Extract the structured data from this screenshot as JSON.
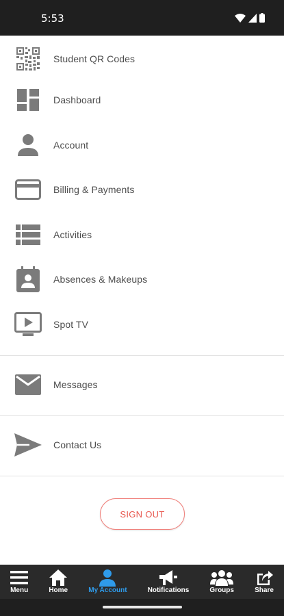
{
  "status_bar": {
    "time": "5:53"
  },
  "menu": {
    "items": [
      {
        "label": "Student QR Codes",
        "icon": "qr-code-icon"
      },
      {
        "label": "Dashboard",
        "icon": "dashboard-icon"
      },
      {
        "label": "Account",
        "icon": "person-icon"
      },
      {
        "label": "Billing & Payments",
        "icon": "credit-card-icon"
      },
      {
        "label": "Activities",
        "icon": "list-icon"
      },
      {
        "label": "Absences & Makeups",
        "icon": "contact-calendar-icon"
      },
      {
        "label": "Spot TV",
        "icon": "tv-play-icon"
      },
      {
        "label": "Messages",
        "icon": "envelope-icon"
      },
      {
        "label": "Contact Us",
        "icon": "send-icon"
      }
    ]
  },
  "sign_out": {
    "label": "SIGN OUT",
    "color": "#e8584f"
  },
  "bottom_nav": {
    "items": [
      {
        "label": "Menu",
        "icon": "hamburger-icon"
      },
      {
        "label": "Home",
        "icon": "home-icon"
      },
      {
        "label": "My Account",
        "icon": "person-icon",
        "active": true
      },
      {
        "label": "Notifications",
        "icon": "megaphone-icon"
      },
      {
        "label": "Groups",
        "icon": "groups-icon"
      },
      {
        "label": "Share",
        "icon": "share-icon"
      }
    ],
    "active_color": "#2f9bea"
  }
}
